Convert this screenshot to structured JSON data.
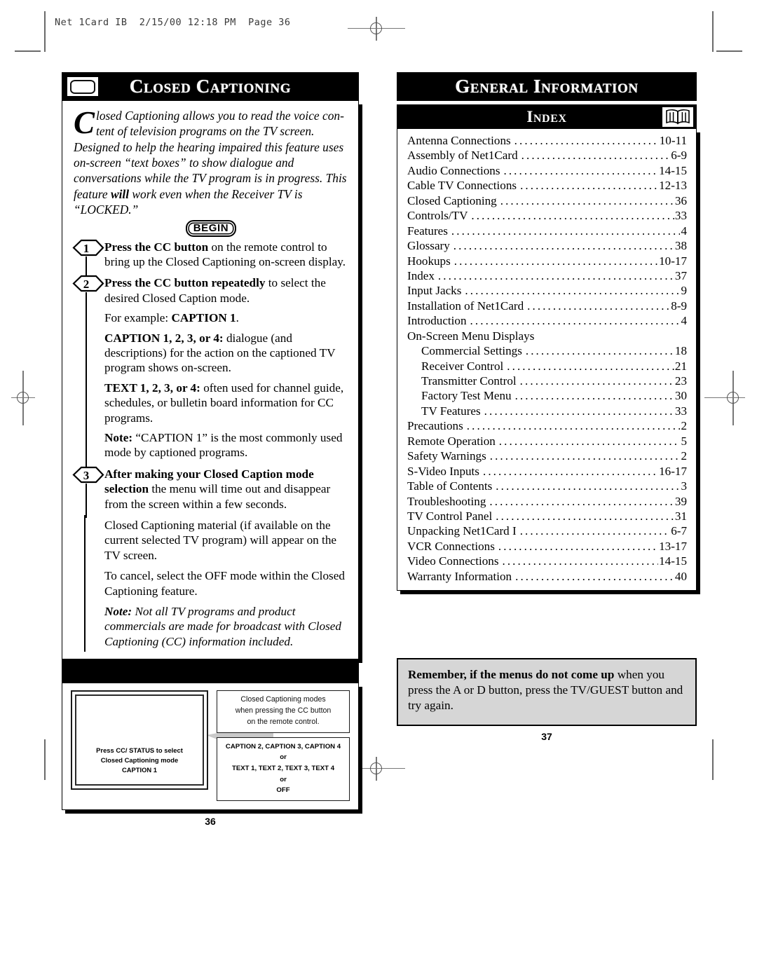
{
  "scan_header": "Net 1Card IB  2/15/00 12:18 PM  Page 36",
  "left_page": {
    "banner_title": "Closed Captioning",
    "tv_icon": "tv-icon",
    "intro": {
      "dropcap": "C",
      "line1": "losed Captioning allows you to read the voice con-",
      "line2": "tent of television programs on the TV screen.",
      "rest_before_bold": "Designed to help the hearing impaired this feature uses on-screen “text boxes” to show dialogue and conversations while the TV program is in progress. This feature ",
      "bold_word": "will",
      "rest_after_bold": " work even when the Receiver TV is “LOCKED.”"
    },
    "begin_label": "BEGIN",
    "steps": [
      {
        "number": "1",
        "bold": "Press the CC button",
        "text": " on the remote control to bring up the Closed Captioning on-screen display."
      },
      {
        "number": "2",
        "bold": "Press the CC button repeatedly",
        "text": " to select the desired Closed Caption mode.",
        "example_prefix": "For example: ",
        "example_bold": "CAPTION 1",
        "example_suffix": ".",
        "caption_bold": "CAPTION 1, 2, 3, or 4:",
        "caption_text": " dialogue (and descriptions) for the action on the captioned TV program shows on-screen.",
        "text_bold": "TEXT 1, 2, 3, or 4:",
        "text_text": " often used for channel guide, schedules, or bulletin board information for CC programs.",
        "note_bold": "Note:",
        "note_text": " “CAPTION 1” is the most commonly used mode by captioned programs."
      },
      {
        "number": "3",
        "bold": "After making your Closed Caption mode selection",
        "text": " the menu will time out and disappear from the screen within a few seconds."
      }
    ],
    "tail_paragraphs": [
      "Closed Captioning material (if available on the current selected TV program) will appear on the TV screen.",
      "To cancel, select the OFF mode within the Closed Captioning feature."
    ],
    "final_note_bold": "Note:",
    "final_note_text": " Not all TV programs and product commercials are made for broadcast with Closed Captioning (CC) information included.",
    "diagram": {
      "tv_screen_lines": [
        "Press CC/ STATUS to select",
        "Closed Captioning mode",
        "CAPTION 1"
      ],
      "callout_top": [
        "Closed Captioning modes",
        "when pressing the CC button",
        "on the remote control."
      ],
      "callout_bottom": [
        "CAPTION 2, CAPTION 3, CAPTION 4",
        "or",
        "TEXT 1, TEXT 2, TEXT 3, TEXT 4",
        "or",
        "OFF"
      ]
    },
    "page_number": "36"
  },
  "right_page": {
    "banner_title": "General Information",
    "index_title": "Index",
    "book_icon": "open-book-icon",
    "index_entries": [
      {
        "name": "Antenna Connections",
        "page": "10-11",
        "sub": false
      },
      {
        "name": "Assembly of Net1Card",
        "page": "6-9",
        "sub": false
      },
      {
        "name": "Audio Connections",
        "page": "14-15",
        "sub": false
      },
      {
        "name": "Cable TV Connections",
        "page": "12-13",
        "sub": false
      },
      {
        "name": "Closed Captioning",
        "page": "36",
        "sub": false
      },
      {
        "name": "Controls/TV",
        "page": "33",
        "sub": false
      },
      {
        "name": "Features",
        "page": "4",
        "sub": false
      },
      {
        "name": "Glossary",
        "page": "38",
        "sub": false
      },
      {
        "name": "Hookups",
        "page": "10-17",
        "sub": false
      },
      {
        "name": "Index",
        "page": "37",
        "sub": false
      },
      {
        "name": "Input Jacks",
        "page": "9",
        "sub": false
      },
      {
        "name": "Installation of Net1Card",
        "page": "8-9",
        "sub": false
      },
      {
        "name": "Introduction",
        "page": "4",
        "sub": false
      },
      {
        "name": "On-Screen Menu Displays",
        "page": "",
        "sub": false,
        "nodots": true
      },
      {
        "name": "Commercial Settings",
        "page": "18",
        "sub": true
      },
      {
        "name": "Receiver Control",
        "page": "21",
        "sub": true
      },
      {
        "name": "Transmitter Control",
        "page": "23",
        "sub": true
      },
      {
        "name": "Factory Test Menu",
        "page": "30",
        "sub": true
      },
      {
        "name": "TV Features",
        "page": "33",
        "sub": true
      },
      {
        "name": "Precautions",
        "page": "2",
        "sub": false
      },
      {
        "name": "Remote Operation",
        "page": "5",
        "sub": false
      },
      {
        "name": "Safety Warnings",
        "page": "2",
        "sub": false
      },
      {
        "name": "S-Video Inputs",
        "page": "16-17",
        "sub": false
      },
      {
        "name": "Table of Contents",
        "page": "3",
        "sub": false
      },
      {
        "name": "Troubleshooting",
        "page": "39",
        "sub": false
      },
      {
        "name": "TV Control Panel",
        "page": "31",
        "sub": false
      },
      {
        "name": "Unpacking Net1Card I",
        "page": "6-7",
        "sub": false
      },
      {
        "name": "VCR Connections",
        "page": "13-17",
        "sub": false
      },
      {
        "name": "Video Connections",
        "page": "14-15",
        "sub": false
      },
      {
        "name": "Warranty Information",
        "page": "40",
        "sub": false
      }
    ],
    "remember_bold": "Remember, if the menus do not come up",
    "remember_text": " when you press the A or D button, press the TV/GUEST button and try again.",
    "page_number": "37"
  }
}
